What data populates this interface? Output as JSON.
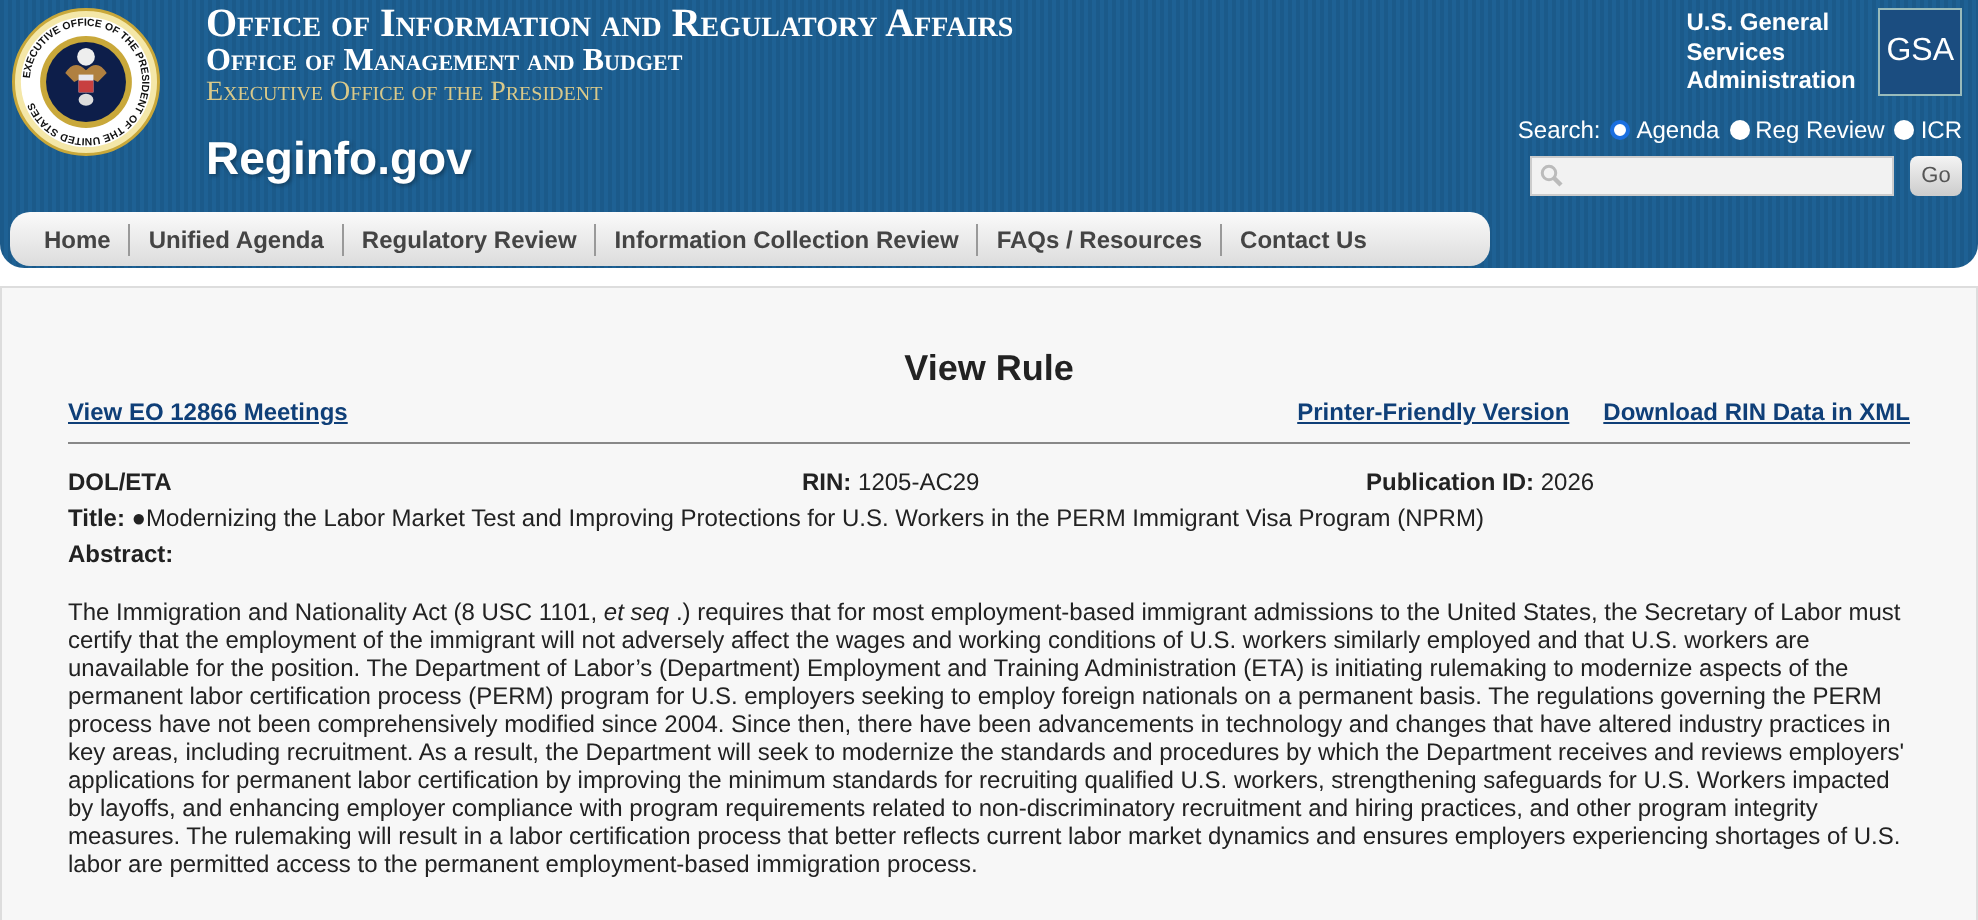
{
  "header": {
    "seal_text": "EXECUTIVE OFFICE OF THE PRESIDENT OF THE UNITED STATES",
    "titles": [
      "Office of Information and Regulatory Affairs",
      "Office of Management and Budget",
      "Executive Office of the President"
    ],
    "site_name": "Reginfo.gov",
    "gsa_text": "U.S. General Services Administration",
    "gsa_logo": "GSA"
  },
  "search": {
    "label": "Search:",
    "options": [
      {
        "label": "Agenda",
        "selected": true
      },
      {
        "label": "Reg Review",
        "selected": false
      },
      {
        "label": "ICR",
        "selected": false
      }
    ],
    "button": "Go"
  },
  "nav": [
    "Home",
    "Unified Agenda",
    "Regulatory Review",
    "Information Collection Review",
    "FAQs / Resources",
    "Contact Us"
  ],
  "page": {
    "heading": "View Rule",
    "left_link": "View EO 12866 Meetings",
    "right_links": [
      "Printer-Friendly Version",
      "Download RIN Data in XML"
    ],
    "agency": "DOL/ETA",
    "rin_label": "RIN:",
    "rin": "1205-AC29",
    "pub_label": "Publication ID:",
    "pub": "2026",
    "title_label": "Title:",
    "title": "●Modernizing the Labor Market Test and Improving Protections for U.S. Workers in the PERM Immigrant Visa Program (NPRM)",
    "abstract_label": "Abstract:",
    "abstract": "The Immigration and Nationality Act (8 USC 1101, *et seq* .) requires that for most employment-based immigrant admissions to the United States, the Secretary of Labor must certify that the employment of the immigrant will not adversely affect the wages and working conditions of U.S. workers similarly employed and that U.S. workers are unavailable for the position. The Department of Labor’s (Department) Employment and Training Administration (ETA) is initiating rulemaking to modernize aspects of the permanent labor certification process (PERM) program for U.S. employers seeking to employ foreign nationals on a permanent basis. The regulations governing the PERM process have not been comprehensively modified since 2004.  Since then, there have been advancements in technology and changes that have altered industry practices in key areas, including recruitment. As a result, the Department will seek to modernize the standards and procedures by which the Department receives and reviews employers' applications for permanent labor certification by improving the minimum standards for recruiting qualified U.S. workers, strengthening safeguards for U.S. Workers impacted by layoffs, and enhancing employer compliance with program requirements related to non-discriminatory recruitment and hiring practices, and other program integrity measures. The rulemaking will result in a labor certification process that better reflects current labor market dynamics and ensures employers experiencing shortages of U.S. labor are permitted access to the permanent employment-based immigration process."
  }
}
